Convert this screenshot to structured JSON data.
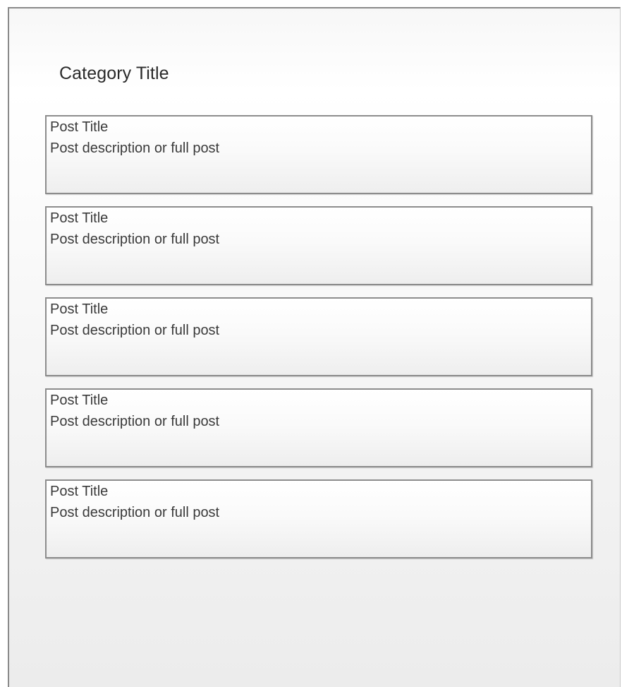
{
  "category": {
    "title": "Category Title"
  },
  "posts": [
    {
      "title": "Post Title",
      "description": "Post description or full post"
    },
    {
      "title": "Post Title",
      "description": "Post description or full post"
    },
    {
      "title": "Post Title",
      "description": "Post description or full post"
    },
    {
      "title": "Post Title",
      "description": "Post description or full post"
    },
    {
      "title": "Post Title",
      "description": "Post description or full post"
    }
  ]
}
